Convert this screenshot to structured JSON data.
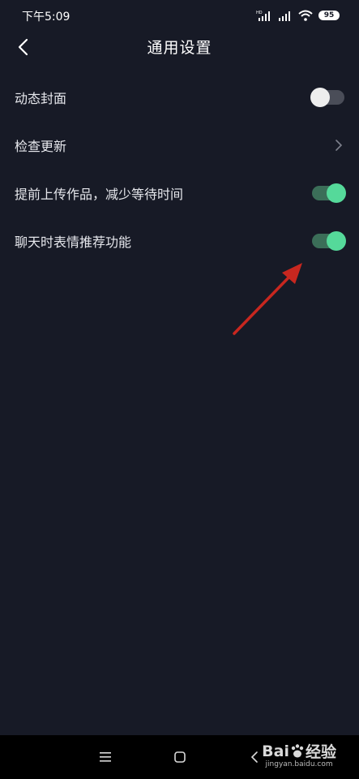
{
  "status_bar": {
    "time": "下午5:09",
    "battery": "95"
  },
  "header": {
    "title": "通用设置"
  },
  "settings": [
    {
      "label": "动态封面",
      "control": "toggle",
      "on": false
    },
    {
      "label": "检查更新",
      "control": "chevron"
    },
    {
      "label": "提前上传作品，减少等待时间",
      "control": "toggle",
      "on": true
    },
    {
      "label": "聊天时表情推荐功能",
      "control": "toggle",
      "on": true
    }
  ],
  "watermark": {
    "brand": "Bai",
    "brand_suffix": "经验",
    "url": "jingyan.baidu.com"
  },
  "colors": {
    "background": "#171a26",
    "toggle_on_track": "#3b6e58",
    "toggle_on_knob": "#55d99a",
    "toggle_off_track": "#4a4d58",
    "annotation_arrow": "#c8271f"
  }
}
